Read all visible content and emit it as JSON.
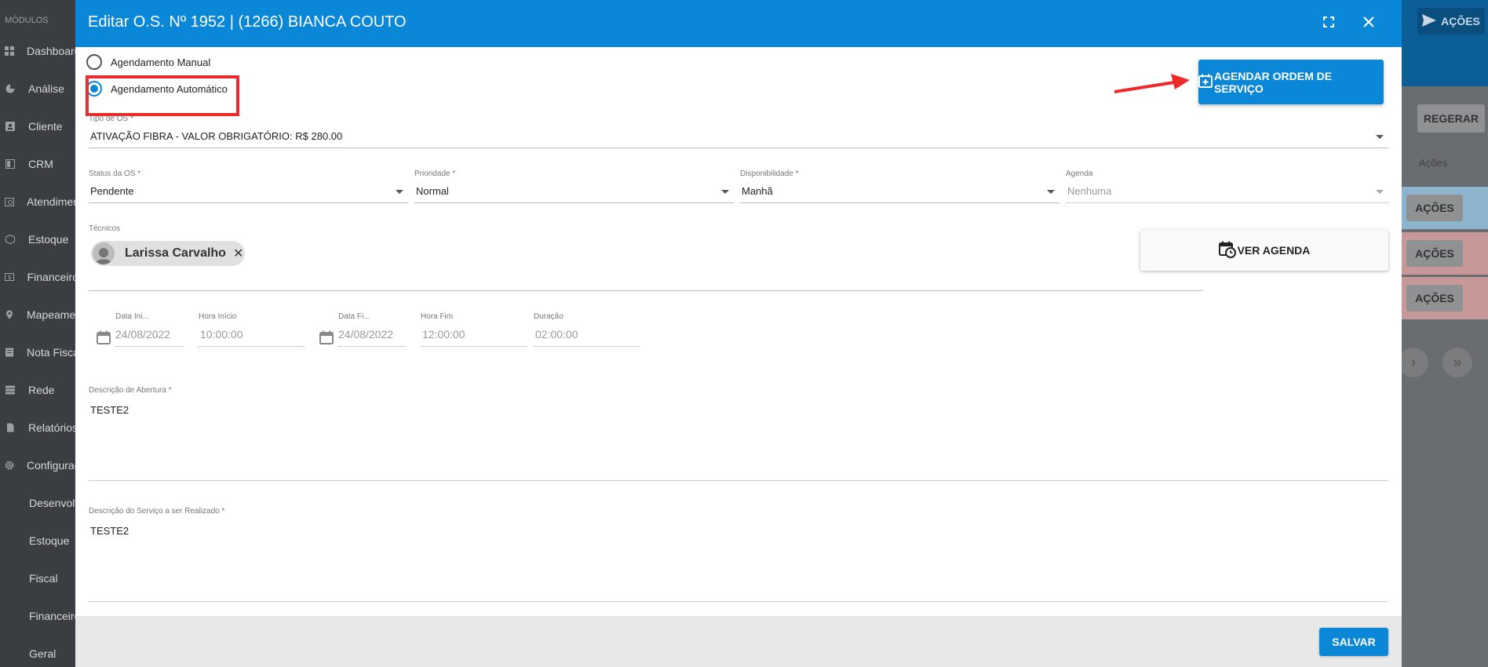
{
  "sidebar": {
    "section_label": "MÓDULOS",
    "items": [
      {
        "label": "Dashboard",
        "icon": "grid-icon"
      },
      {
        "label": "Análise",
        "icon": "pie-chart-icon"
      },
      {
        "label": "Cliente",
        "icon": "contact-icon"
      },
      {
        "label": "CRM",
        "icon": "board-icon"
      },
      {
        "label": "Atendimento",
        "icon": "calendar-clock-icon"
      },
      {
        "label": "Estoque",
        "icon": "box-icon"
      },
      {
        "label": "Financeiro",
        "icon": "money-icon"
      },
      {
        "label": "Mapeamento",
        "icon": "map-pin-icon"
      },
      {
        "label": "Nota Fiscal",
        "icon": "receipt-icon"
      },
      {
        "label": "Rede",
        "icon": "network-icon"
      },
      {
        "label": "Relatórios",
        "icon": "document-icon"
      },
      {
        "label": "Configurações",
        "icon": "gear-icon"
      }
    ],
    "subitems": [
      "Desenvolvimento",
      "Estoque",
      "Fiscal",
      "Financeiro",
      "Geral"
    ]
  },
  "background": {
    "acoes_top": "AÇÕES",
    "regerar": "REGERAR",
    "acoes_header": "Ações",
    "row_buttons": [
      "AÇÕES",
      "AÇÕES",
      "AÇÕES"
    ],
    "row_colors": [
      "#8eb3cc",
      "#c79898",
      "#c79898"
    ]
  },
  "dialog": {
    "title": "Editar O.S. Nº 1952 | (1266) BIANCA COUTO",
    "scheduling": {
      "manual_label": "Agendamento Manual",
      "auto_label": "Agendamento Automático",
      "selected": "auto"
    },
    "schedule_button": "AGENDAR ORDEM DE SERVIÇO",
    "tipo_os": {
      "label": "Tipo de OS *",
      "value": "ATIVAÇÃO FIBRA - VALOR OBRIGATÓRIO: R$ 280.00"
    },
    "status_os": {
      "label": "Status da OS *",
      "value": "Pendente"
    },
    "prioridade": {
      "label": "Prioridade *",
      "value": "Normal"
    },
    "disponibilidade": {
      "label": "Disponibilidade *",
      "value": "Manhã"
    },
    "agenda": {
      "label": "Agenda",
      "value": "Nenhuma"
    },
    "tecnicos": {
      "label": "Técnicos",
      "chips": [
        "Larissa Carvalho"
      ]
    },
    "ver_agenda_button": "VER AGENDA",
    "data_inicio": {
      "label": "Data Ini...",
      "value": "24/08/2022"
    },
    "hora_inicio": {
      "label": "Hora Início",
      "value": "10:00:00"
    },
    "data_fim": {
      "label": "Data Fi...",
      "value": "24/08/2022"
    },
    "hora_fim": {
      "label": "Hora Fim",
      "value": "12:00:00"
    },
    "duracao": {
      "label": "Duração",
      "value": "02:00:00"
    },
    "descricao_abertura": {
      "label": "Descrição de Abertura *",
      "value": "TESTE2"
    },
    "descricao_servico": {
      "label": "Descrição do Serviço a ser Realizado *",
      "value": "TESTE2"
    },
    "save_button": "SALVAR"
  },
  "colors": {
    "primary": "#0a87d6",
    "highlight": "#ee2a2a"
  }
}
